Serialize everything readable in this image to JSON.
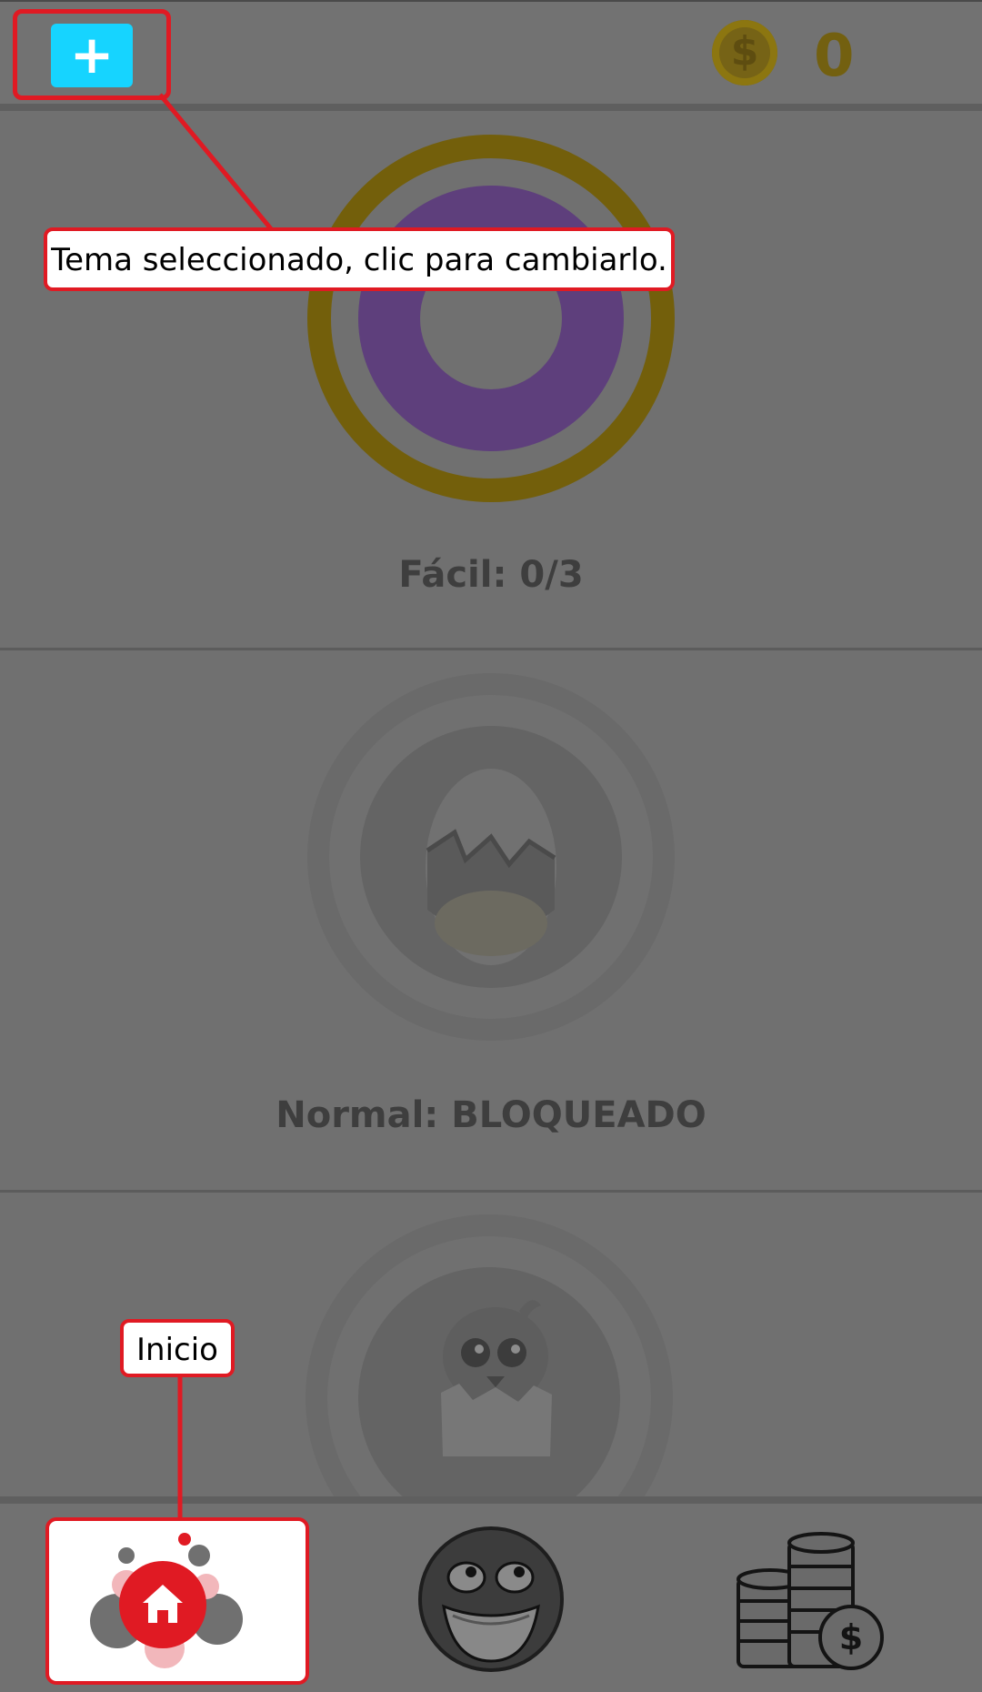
{
  "header": {
    "theme_button_glyph": "+",
    "coin_icon": "coin-dollar-icon",
    "coin_glyph": "$",
    "coin_count": "0"
  },
  "levels": [
    {
      "label": "Fácil: 0/3",
      "status": "unlocked",
      "ring_outer": "#735f0b",
      "ring_inner": "#5e3f7c"
    },
    {
      "label": "Normal: BLOQUEADO",
      "status": "locked",
      "icon": "cracked-egg-icon"
    },
    {
      "label": "",
      "status": "locked",
      "icon": "hatching-chick-icon"
    }
  ],
  "bottom_nav": {
    "items": [
      {
        "name": "Inicio",
        "icon": "home-icon"
      },
      {
        "name": "",
        "icon": "smiley-face-icon"
      },
      {
        "name": "",
        "icon": "coin-stack-icon"
      }
    ]
  },
  "annotations": {
    "theme": "Tema seleccionado, clic para cambiarlo.",
    "home": "Inicio"
  },
  "colors": {
    "accent_cyan": "#16d4ff",
    "accent_red": "#e01a23",
    "overlay_gray": "#707070"
  }
}
